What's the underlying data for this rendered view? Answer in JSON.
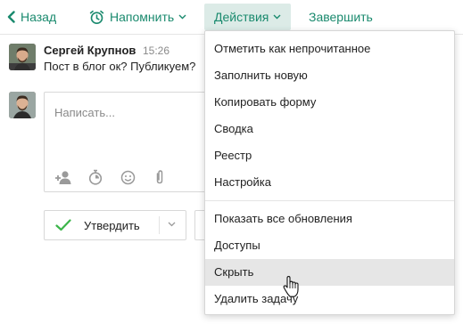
{
  "toolbar": {
    "back_label": "Назад",
    "remind_label": "Напомнить",
    "actions_label": "Действия",
    "finish_label": "Завершить"
  },
  "message": {
    "author": "Сергей Крупнов",
    "time": "15:26",
    "text": "Пост в блог ок? Публикуем?"
  },
  "composer": {
    "placeholder": "Написать..."
  },
  "approve": {
    "label": "Утвердить"
  },
  "menu": {
    "group1": [
      "Отметить как непрочитанное",
      "Заполнить новую",
      "Копировать форму",
      "Сводка",
      "Реестр",
      "Настройка"
    ],
    "group2": [
      "Показать все обновления",
      "Доступы",
      "Скрыть",
      "Удалить задачу"
    ],
    "hovered_item": "Скрыть"
  },
  "colors": {
    "accent": "#1a8a6e",
    "active_tab_bg": "#dcebe7",
    "check_green": "#3cb54a"
  }
}
